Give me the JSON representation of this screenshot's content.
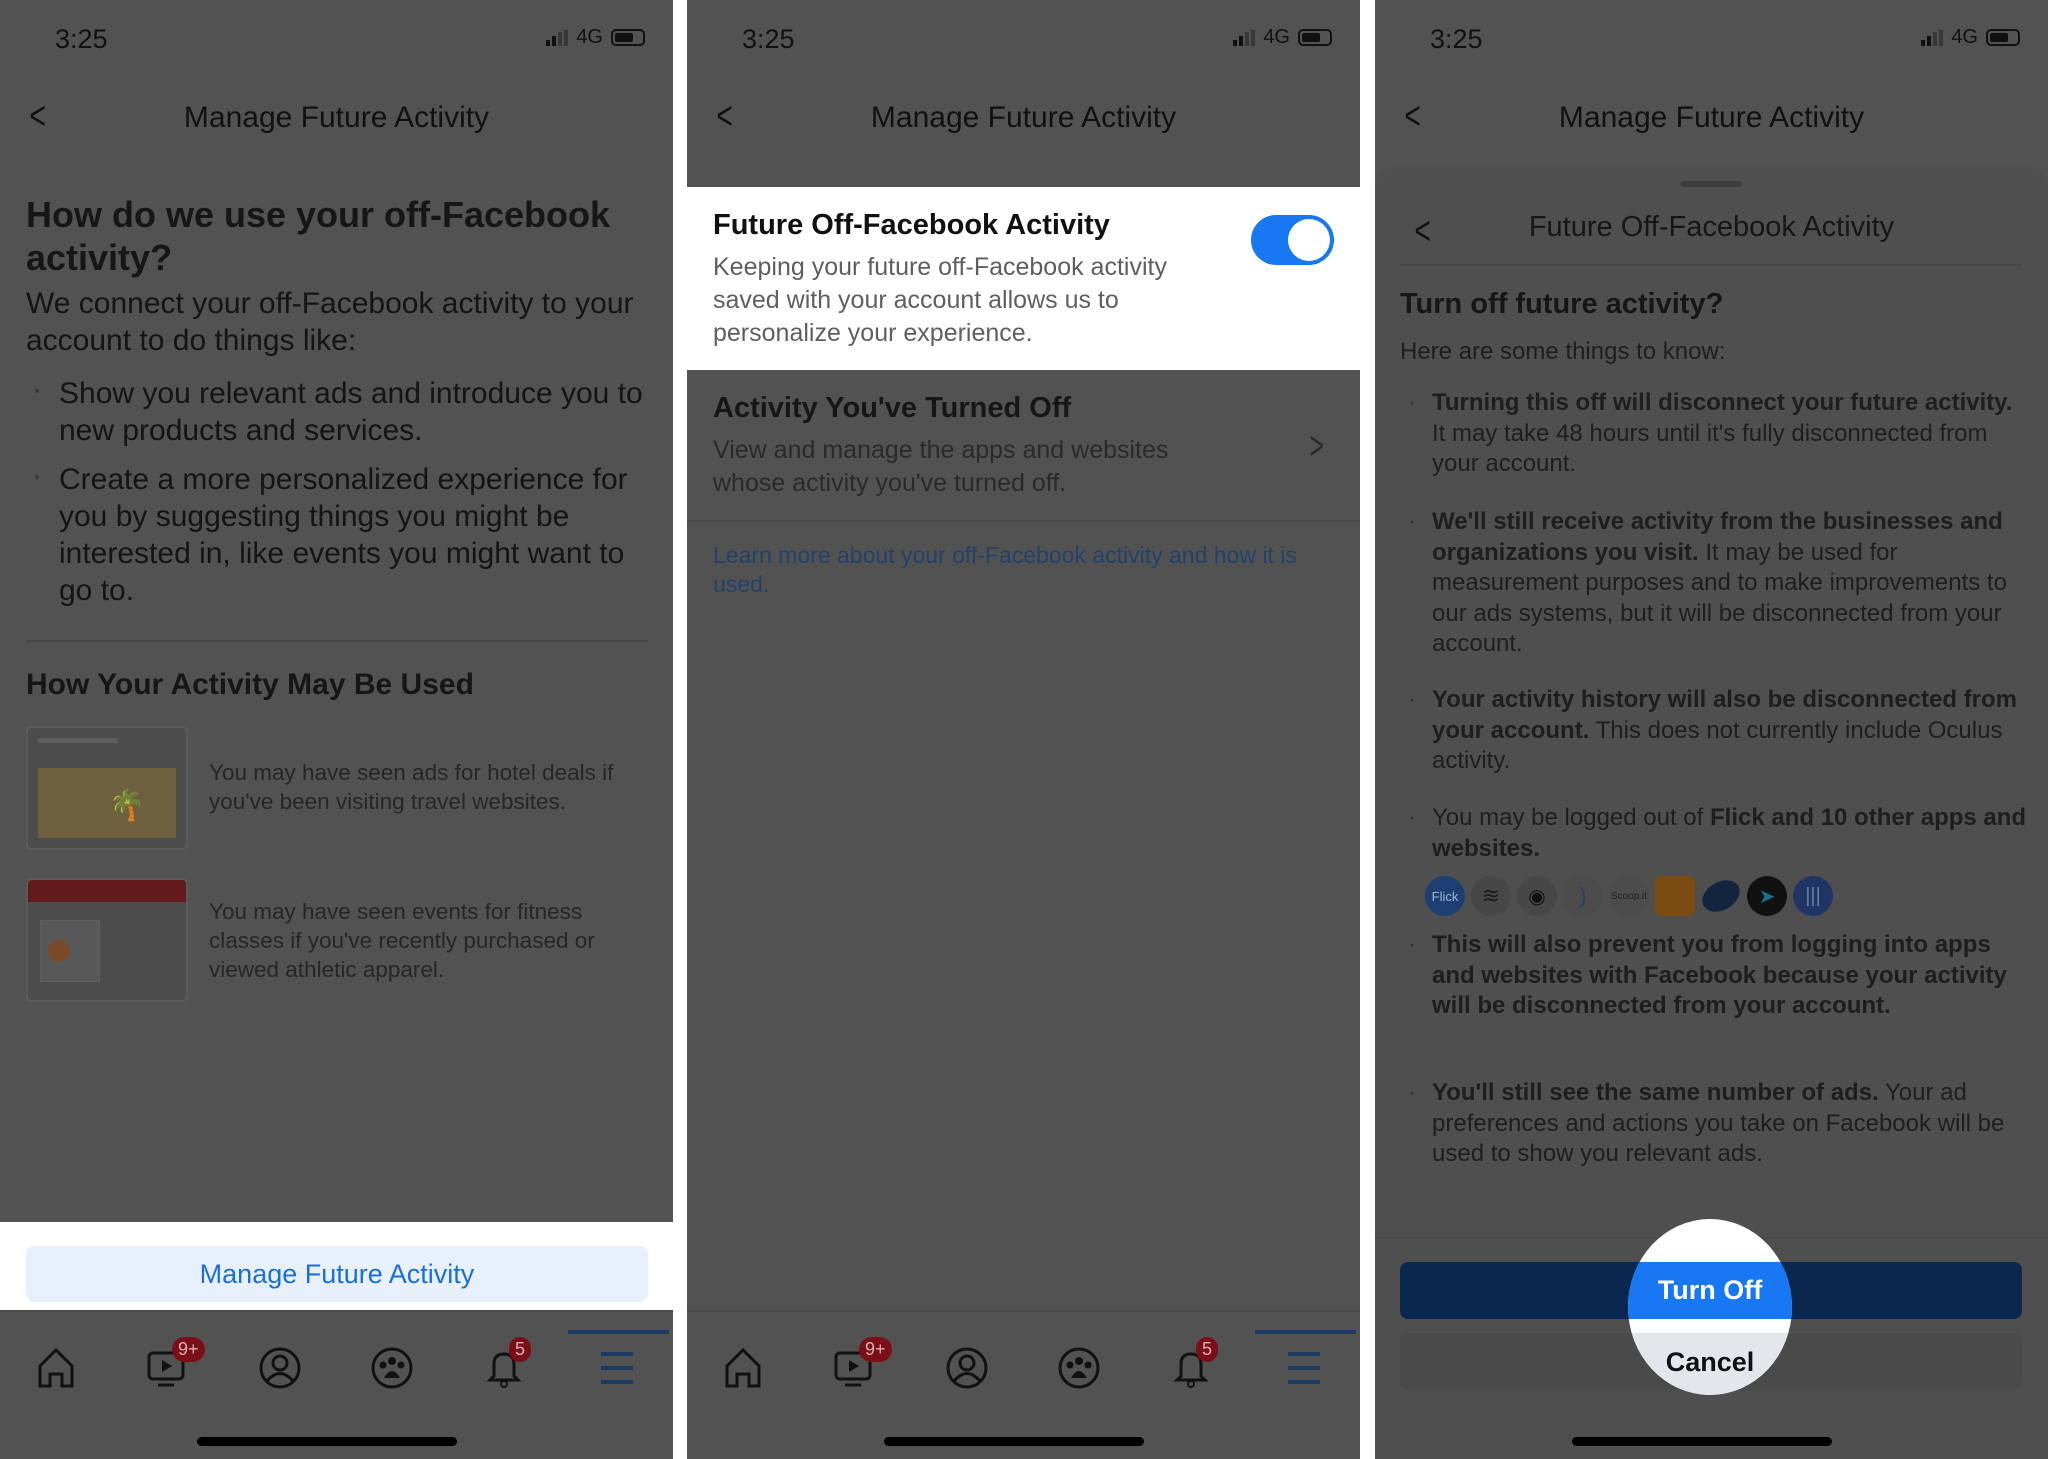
{
  "status": {
    "time": "3:25",
    "network": "4G"
  },
  "header": {
    "title": "Manage Future Activity"
  },
  "panel1": {
    "heading": "How do we use your off-Facebook activity?",
    "intro": "We connect your off-Facebook activity to your account to do things like:",
    "bullets": [
      "Show you relevant ads and introduce you to new products and services.",
      "Create a more personalized experience for you by suggesting things you might be interested in, like events you might want to go to."
    ],
    "section_title": "How Your Activity May Be Used",
    "examples": [
      {
        "text": "You may have seen ads for hotel deals if you've been visiting travel websites."
      },
      {
        "text": "You may have seen events for fitness classes if you've recently purchased or viewed athletic apparel."
      }
    ],
    "button": "Manage Future Activity"
  },
  "panel2": {
    "toggle_title": "Future Off-Facebook Activity",
    "toggle_desc": "Keeping your future off-Facebook activity saved with your account allows us to personalize your experience.",
    "toggle_on": true,
    "off_title": "Activity You've Turned Off",
    "off_desc": "View and manage the apps and websites whose activity you've turned off.",
    "link": "Learn more about your off-Facebook activity and how it is used."
  },
  "panel3": {
    "sheet_title": "Future Off-Facebook Activity",
    "question": "Turn off future activity?",
    "subtitle": "Here are some things to know:",
    "b1_bold": "Turning this off will disconnect your future activity.",
    "b1_rest": " It may take 48 hours until it's fully disconnected from your account.",
    "b2_bold": "We'll still receive activity from the businesses and organizations you visit.",
    "b2_rest": " It may be used for measurement purposes and to make improvements to our ads systems, but it will be disconnected from your account.",
    "b3_bold": "Your activity history will also be disconnected from your account.",
    "b3_rest": " This does not currently include Oculus activity.",
    "b4_pre": "You may be logged out of ",
    "b4_bold": "Flick and 10 other apps and websites.",
    "app_icons": [
      "Flick",
      "buffer",
      "hootsuite",
      "rss",
      "Scoop.it",
      "package",
      "disc",
      "arrow",
      "bars"
    ],
    "b5_bold": "This will also prevent you from logging into apps and websites with Facebook because your activity will be disconnected from your account.",
    "b6_bold": "You'll still see the same number of ads.",
    "b6_rest": " Your ad preferences and actions you take on Facebook will be used to show you relevant ads.",
    "turn_off": "Turn Off",
    "cancel": "Cancel"
  },
  "tabbar": {
    "watch_badge": "9+",
    "notif_badge": "5"
  },
  "colors": {
    "accent": "#1877f2",
    "dim_bg": "#525252",
    "badge": "#7a0f17"
  }
}
